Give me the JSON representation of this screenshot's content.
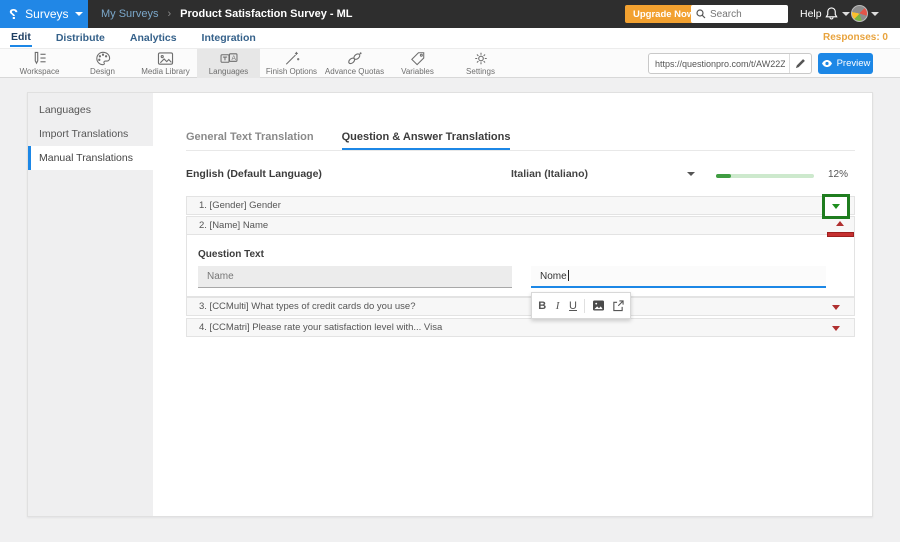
{
  "topbar": {
    "logo_glyph": "?",
    "product_label": "Surveys",
    "breadcrumb_parent": "My Surveys",
    "breadcrumb_sep": "›",
    "breadcrumb_title": "Product Satisfaction Survey - ML",
    "upgrade_label": "Upgrade Now",
    "search_placeholder": "Search",
    "help_label": "Help"
  },
  "nav": {
    "items": [
      {
        "label": "Edit"
      },
      {
        "label": "Distribute"
      },
      {
        "label": "Analytics"
      },
      {
        "label": "Integration"
      }
    ],
    "responses_label": "Responses: 0"
  },
  "toolbar": {
    "items": [
      {
        "label": "Workspace"
      },
      {
        "label": "Design"
      },
      {
        "label": "Media Library"
      },
      {
        "label": "Languages"
      },
      {
        "label": "Finish Options"
      },
      {
        "label": "Advance Quotas"
      },
      {
        "label": "Variables"
      },
      {
        "label": "Settings"
      }
    ],
    "active_item": "Languages",
    "survey_url": "https://questionpro.com/t/AW22Zd1S1",
    "preview_label": "Preview"
  },
  "sidebar": {
    "items": [
      {
        "label": "Languages"
      },
      {
        "label": "Import Translations"
      },
      {
        "label": "Manual Translations"
      }
    ],
    "active_item": "Manual Translations"
  },
  "main": {
    "tabs": [
      {
        "label": "General Text Translation"
      },
      {
        "label": "Question & Answer Translations"
      }
    ],
    "active_tab": "Question & Answer Translations",
    "source_language": "English (Default Language)",
    "target_language": "Italian (Italiano)",
    "progress_percent": "12%",
    "questions": [
      {
        "label": "1. [Gender] Gender"
      },
      {
        "label": "2. [Name] Name"
      },
      {
        "label": "3. [CCMulti] What types of credit cards do you use?"
      },
      {
        "label": "4. [CCMatri] Please rate your satisfaction level with... Visa"
      }
    ],
    "editor": {
      "field_label": "Question Text",
      "source_value": "Name",
      "target_value": "Nome",
      "bold_label": "B",
      "italic_label": "I",
      "underline_label": "U"
    }
  },
  "colors": {
    "accent_blue": "#1C87E6",
    "upgrade_orange": "#F2A130",
    "responses_orange": "#E8A33D",
    "progress_green": "#3F9C42",
    "caret_red": "#B03030",
    "annotation_green": "#1F7D1F"
  }
}
